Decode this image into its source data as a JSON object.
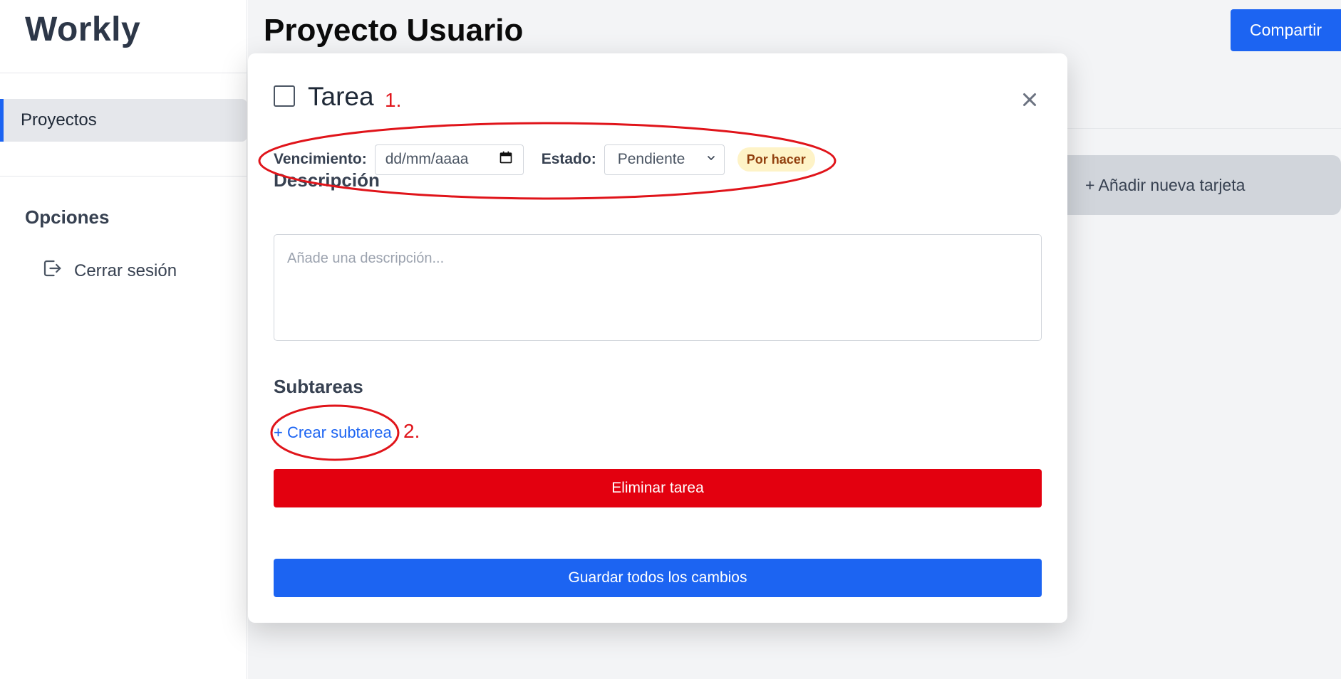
{
  "app": {
    "logo": "Workly"
  },
  "sidebar": {
    "nav": [
      {
        "label": "Proyectos",
        "active": true
      }
    ],
    "options_title": "Opciones",
    "logout_label": "Cerrar sesión",
    "logout_icon": "logout-icon"
  },
  "header": {
    "title": "Proyecto Usuario",
    "share_label": "Compartir"
  },
  "board": {
    "add_card_label": "+ Añadir nueva tarjeta"
  },
  "modal": {
    "title": "Tarea",
    "checkbox_checked": false,
    "close_icon": "close-icon",
    "due_label": "Vencimiento:",
    "due_value": "dd/mm/aaaa",
    "status_label": "Estado:",
    "status_value": "Pendiente",
    "status_badge": "Por hacer",
    "description_title": "Descripción",
    "description_placeholder": "Añade una descripción...",
    "subtasks_title": "Subtareas",
    "create_subtask_label": "+ Crear subtarea",
    "delete_label": "Eliminar tarea",
    "save_label": "Guardar todos los cambios"
  },
  "annotations": {
    "first": "1.",
    "second": "2."
  },
  "colors": {
    "accent": "#1c64f2",
    "danger": "#e3000f",
    "annotation": "#e0141a",
    "badge_bg": "#fef3c7",
    "badge_text": "#92400e"
  }
}
